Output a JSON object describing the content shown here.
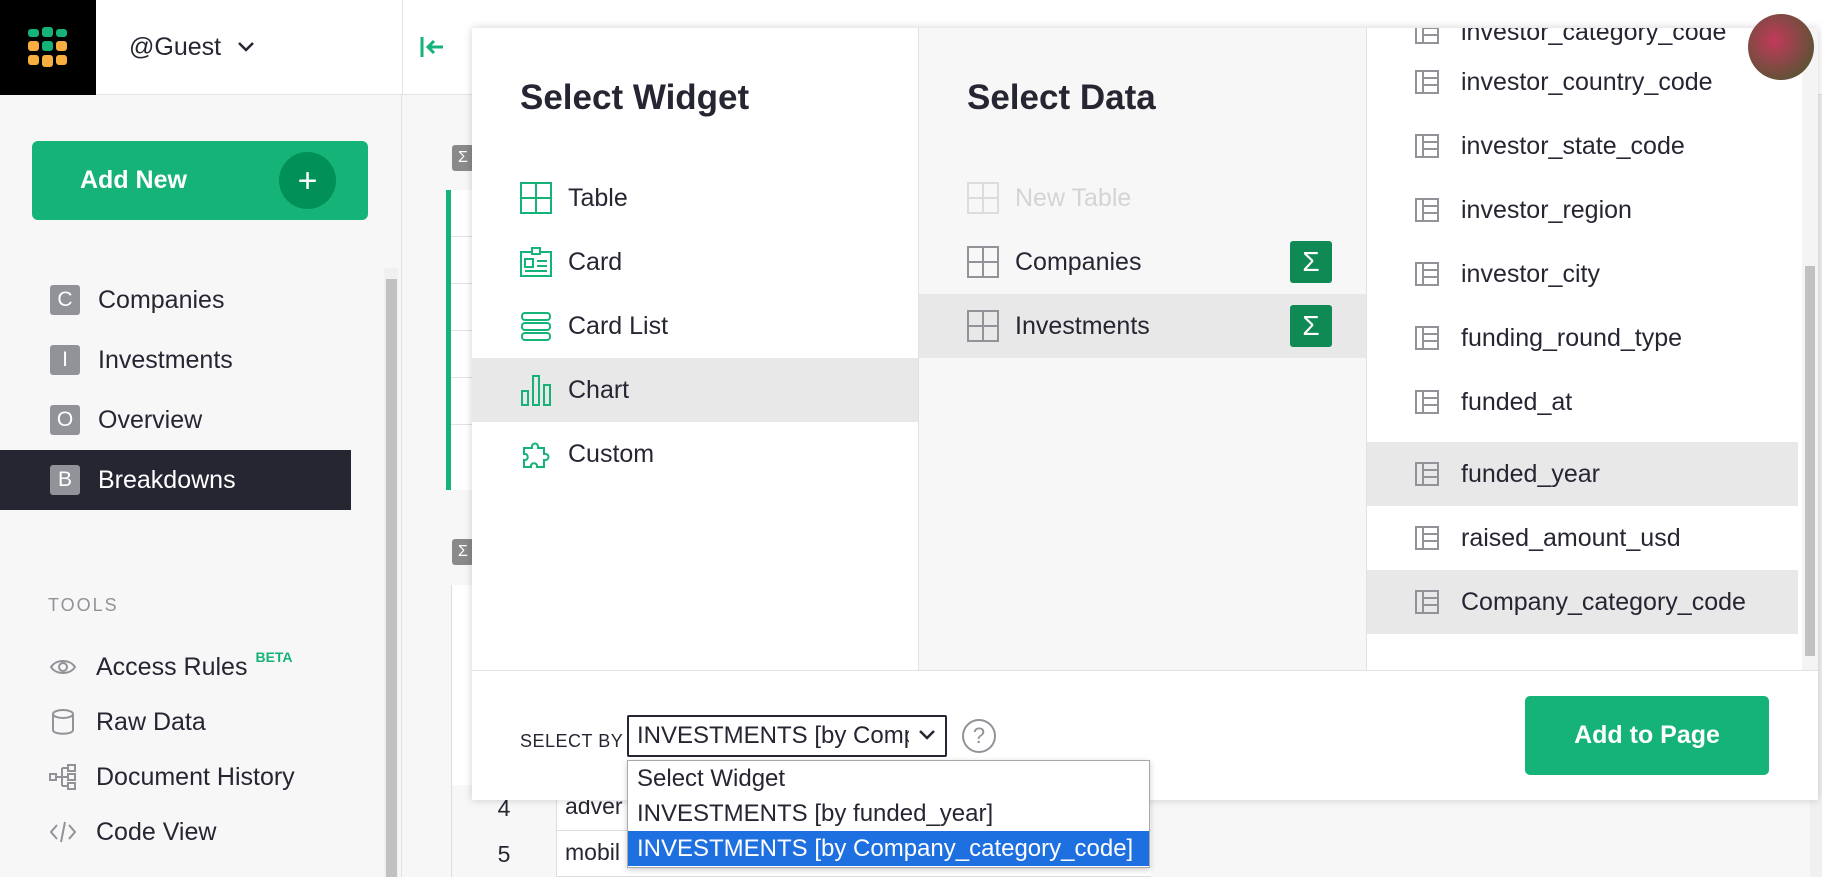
{
  "org": {
    "name": "@Guest"
  },
  "left": {
    "add_new": "Add New",
    "pages": [
      {
        "letter": "C",
        "label": "Companies"
      },
      {
        "letter": "I",
        "label": "Investments"
      },
      {
        "letter": "O",
        "label": "Overview"
      },
      {
        "letter": "B",
        "label": "Breakdowns"
      }
    ],
    "tools_heading": "TOOLS",
    "tools": [
      {
        "label": "Access Rules",
        "badge": "BETA",
        "icon": "eye-icon"
      },
      {
        "label": "Raw Data",
        "icon": "database-icon"
      },
      {
        "label": "Document History",
        "icon": "history-icon"
      },
      {
        "label": "Code View",
        "icon": "code-icon"
      }
    ]
  },
  "background_table": {
    "rows": [
      {
        "num": "4",
        "cell": "adver"
      },
      {
        "num": "5",
        "cell": "mobil"
      }
    ]
  },
  "modal": {
    "widget_title": "Select Widget",
    "widgets": [
      {
        "label": "Table",
        "icon": "table-icon"
      },
      {
        "label": "Card",
        "icon": "card-icon"
      },
      {
        "label": "Card List",
        "icon": "card-list-icon"
      },
      {
        "label": "Chart",
        "icon": "chart-icon",
        "selected": true
      },
      {
        "label": "Custom",
        "icon": "custom-icon"
      }
    ],
    "data_title": "Select Data",
    "data_items": [
      {
        "label": "New Table",
        "disabled": true
      },
      {
        "label": "Companies",
        "sum": "Σ"
      },
      {
        "label": "Investments",
        "sum": "Σ",
        "selected": true
      }
    ],
    "fields": [
      {
        "label": "investor_category_code"
      },
      {
        "label": "investor_country_code"
      },
      {
        "label": "investor_state_code"
      },
      {
        "label": "investor_region"
      },
      {
        "label": "investor_city"
      },
      {
        "label": "funding_round_type"
      },
      {
        "label": "funded_at"
      },
      {
        "label": "funded_year",
        "selected": true
      },
      {
        "label": "raised_amount_usd"
      },
      {
        "label": "Company_category_code",
        "selected": true
      }
    ],
    "select_by_label": "SELECT BY",
    "select_by_value": "INVESTMENTS [by Company_category_code]",
    "help": "?",
    "add_to_page": "Add to Page"
  },
  "dropdown": {
    "options": [
      "Select Widget",
      "INVESTMENTS [by funded_year]",
      "INVESTMENTS [by Company_category_code]"
    ],
    "highlighted_index": 2
  },
  "colors": {
    "accent": "#16b378",
    "dark_accent": "#0f8a55",
    "highlight": "#1e6fe0"
  }
}
